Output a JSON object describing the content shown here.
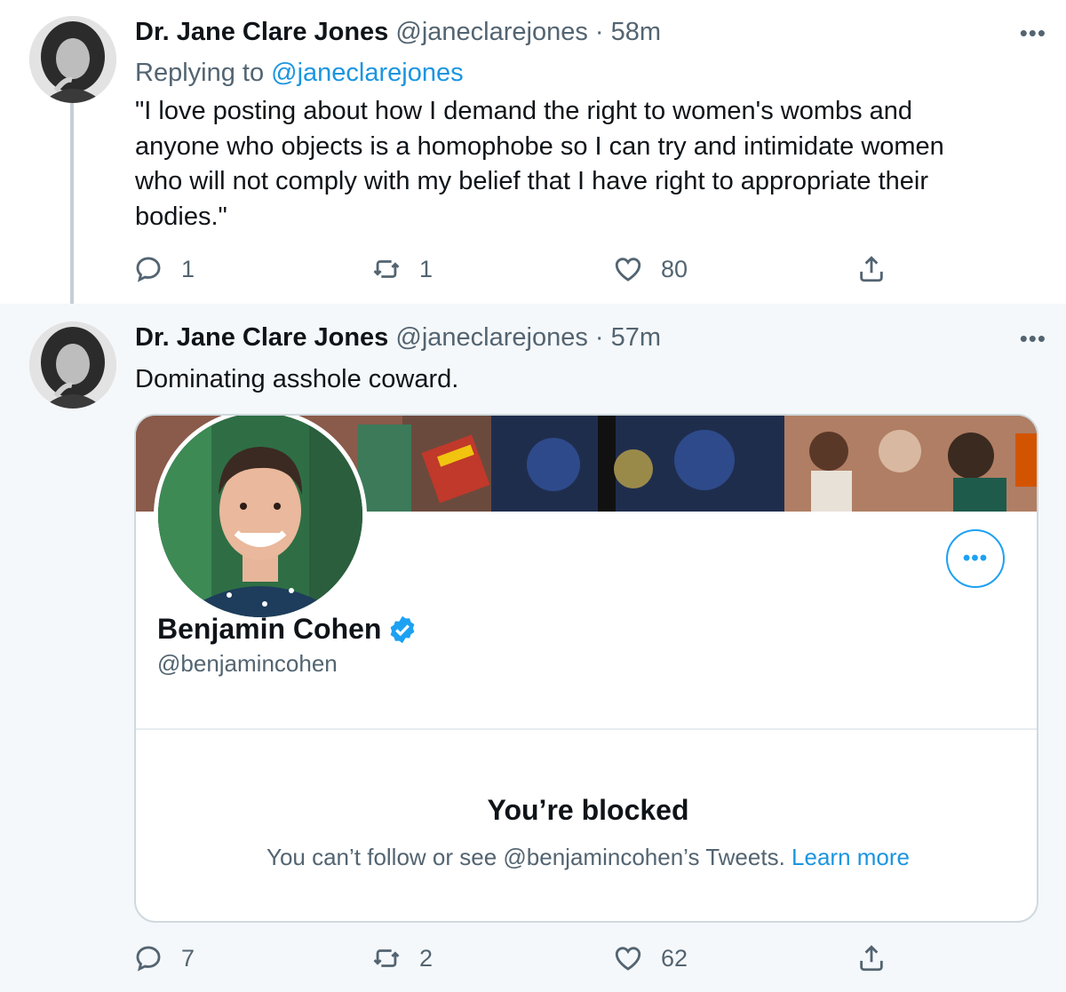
{
  "tweets": [
    {
      "display_name": "Dr. Jane Clare Jones",
      "handle": "@janeclarejones",
      "separator": "·",
      "time": "58m",
      "replying_label": "Replying to",
      "replying_to": "@janeclarejones",
      "text_lines": [
        "\"I love posting about how I demand the right to women's wombs and",
        "anyone who objects is a homophobe so I can try and intimidate women",
        "who will not comply with my belief that I have right to appropriate their",
        "bodies.\""
      ],
      "reply_count": "1",
      "retweet_count": "1",
      "like_count": "80"
    },
    {
      "display_name": "Dr. Jane Clare Jones",
      "handle": "@janeclarejones",
      "separator": "·",
      "time": "57m",
      "text": "Dominating asshole coward.",
      "reply_count": "7",
      "retweet_count": "2",
      "like_count": "62"
    }
  ],
  "quoted_profile": {
    "name": "Benjamin Cohen",
    "handle": "@benjamincohen",
    "verified": true,
    "blocked_title": "You’re blocked",
    "blocked_desc": "You can’t follow or see @benjamincohen’s Tweets.",
    "learn_more": "Learn more"
  },
  "icons": {
    "more": "more-horizontal-icon",
    "reply": "reply-icon",
    "retweet": "retweet-icon",
    "like": "heart-icon",
    "share": "share-icon",
    "verified": "verified-badge-icon"
  },
  "colors": {
    "accent": "#1da1f2",
    "link": "#1b95e0",
    "muted_text": "#536471",
    "thread_line": "#c4cfd6",
    "second_tweet_bg": "#f5f8fa"
  }
}
